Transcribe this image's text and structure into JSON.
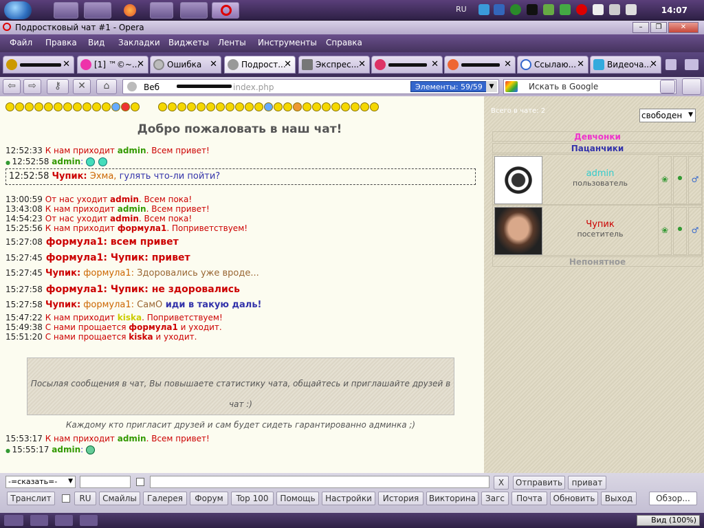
{
  "taskbar": {
    "lang": "RU",
    "clock": "14:07"
  },
  "window": {
    "title": "Подростковый чат #1 - Opera",
    "min": "–",
    "max": "❐",
    "close": "✕"
  },
  "menu": [
    "Файл",
    "Правка",
    "Вид",
    "Закладки",
    "Виджеты",
    "Ленты",
    "Инструменты",
    "Справка"
  ],
  "tabs": [
    {
      "label": "",
      "close": "✕"
    },
    {
      "label": "[1] ™©~...",
      "close": "✕"
    },
    {
      "label": "Ошибка",
      "close": "✕"
    },
    {
      "label": "Подрост...",
      "close": "✕"
    },
    {
      "label": "Экспрес...",
      "close": "✕"
    },
    {
      "label": "",
      "close": "✕"
    },
    {
      "label": "",
      "close": "✕"
    },
    {
      "label": "Ссылаю...",
      "close": "✕"
    },
    {
      "label": "Видеоча...",
      "close": "✕"
    }
  ],
  "nav": {
    "back": "⇦",
    "forward": "⇨",
    "wand": "⚷",
    "stop": "✕",
    "home": "⌂",
    "address_label": "Веб",
    "address_url": "index.php",
    "elements": "Элементы:  59/59",
    "search_placeholder": "Искать в Google"
  },
  "chat": {
    "welcome": "Добро пожаловать в наш чат!",
    "messages": [
      {
        "time": "12:52:33",
        "pre": " К нам приходит ",
        "nick": "admin",
        "post": ". Всем привет!"
      },
      {
        "time": "12:52:58",
        "nick": "admin",
        "post": ":"
      },
      {
        "time": "12:52:58",
        "nick": "Чупик:",
        "post1": " Эхма,",
        "post2": " гулять что-ли пойти?"
      },
      {
        "time": "13:00:59",
        "pre": " От нас уходит ",
        "nick": "admin",
        "post": ". Всем пока!"
      },
      {
        "time": "13:43:08",
        "pre": " К нам приходит ",
        "nick": "admin",
        "post": ". Всем привет!"
      },
      {
        "time": "14:54:23",
        "pre": " От нас уходит ",
        "nick": "admin",
        "post": ". Всем пока!"
      },
      {
        "time": "15:25:56",
        "pre": " К нам приходит ",
        "nick": "формула1",
        "post": ". Поприветствуем!"
      },
      {
        "time": "15:27:08",
        "nick": "формула1:",
        "post": " всем привет"
      },
      {
        "time": "15:27:45",
        "nick": "формула1:",
        "post": " Чупик: привет"
      },
      {
        "time": "15:27:45",
        "nick": "Чупик:",
        "post1": " формула1:",
        "post2": " Здоровались уже вроде..."
      },
      {
        "time": "15:27:58",
        "nick": "формула1:",
        "post": " Чупик: не здоровались"
      },
      {
        "time": "15:27:58",
        "nick": "Чупик:",
        "post1": " формула1:",
        "post2": " СамО",
        "post3": " иди в такую даль!"
      },
      {
        "time": "15:47:22",
        "pre": " К нам приходит ",
        "nick": "kiska",
        "post": ". Поприветствуем!"
      },
      {
        "time": "15:49:38",
        "pre": " С нами прощается ",
        "nick": "формула1",
        "post": " и уходит."
      },
      {
        "time": "15:51:20",
        "pre": " С нами прощается ",
        "nick": "kiska",
        "post": " и уходит."
      },
      {
        "time": "15:53:17",
        "pre": " К нам приходит ",
        "nick": "admin",
        "post": ". Всем привет!"
      },
      {
        "time": "15:55:17",
        "nick": "admin",
        "post": ":"
      }
    ],
    "notice_line1": "Посылая сообщения в чат, Вы повышаете статистику чата, общайтесь и приглашайте друзей в чат :)",
    "notice_line2": "Каждому кто пригласит друзей и сам будет сидеть гарантированно админка ;)"
  },
  "sidebar": {
    "title": "Всего в чате: 2",
    "status": "свободен",
    "cat_girls": "Девчонки",
    "cat_boys": "Пацанчики",
    "cat_other": "Непонятное",
    "users": [
      {
        "name": "admin",
        "role": "пользователь",
        "name_color": "#33cccc"
      },
      {
        "name": "Чупик",
        "role": "посетитель",
        "name_color": "#cc0000"
      }
    ],
    "gender_icon": "♂",
    "flower_icon": "❀",
    "dot_icon": "●"
  },
  "bottom": {
    "say": "-=сказать=-",
    "clear": "X",
    "send": "Отправить",
    "private": "приват",
    "buttons": [
      "Транслит",
      "RU",
      "Смайлы",
      "Галерея",
      "Форум",
      "Top 100",
      "Помощь",
      "Настройки",
      "История",
      "Викторина",
      "Загс",
      "Почта",
      "Обновить",
      "Выход"
    ],
    "browse": "Обзор..."
  },
  "statusbar": {
    "zoom": "Вид (100%)"
  },
  "colors": {
    "admin_a": "#cc0000",
    "admin_rest": "#339900",
    "admin_end": "#3333cc",
    "chupik": "#cc0000",
    "formula": "#cc6600",
    "text_brown": "#996600",
    "text_blue": "#3333aa",
    "kiska": "#cccc00"
  }
}
